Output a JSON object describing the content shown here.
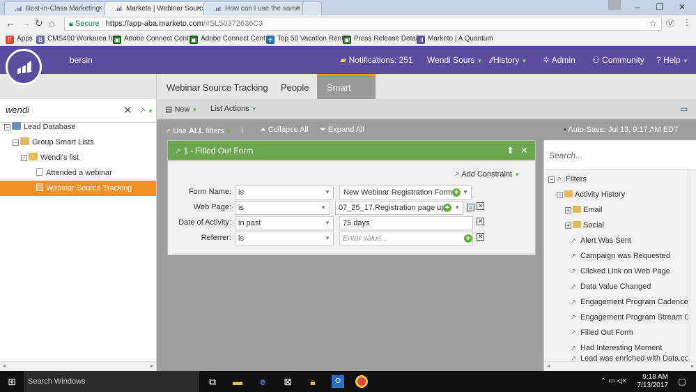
{
  "browser": {
    "tabs": [
      {
        "title": "Best-in-Class Marketing",
        "active": false
      },
      {
        "title": "Marketo | Webinar Sourc",
        "active": true
      },
      {
        "title": "How can I use the same",
        "active": false
      }
    ],
    "secure_label": "Secure",
    "url_host": "https://app-aba.marketo.com",
    "url_path": "/#SL50372636C3",
    "bookmarks": [
      {
        "label": "Apps"
      },
      {
        "label": "CMS400 Workarea fo"
      },
      {
        "label": "Adobe Connect Cent"
      },
      {
        "label": "Adobe Connect Cent"
      },
      {
        "label": "Top 50 Vacation Rent"
      },
      {
        "label": "Press Release Details"
      },
      {
        "label": "Marketo | A Quantum"
      }
    ]
  },
  "header": {
    "username": "bersin",
    "notifications": "Notifications: 251",
    "user_menu": "Wendi Sours",
    "history": "History",
    "admin": "Admin",
    "community": "Community",
    "help": "Help"
  },
  "subnav": {
    "tabs": [
      "Webinar Source Tracking",
      "People",
      "Smart List"
    ]
  },
  "left_panel": {
    "search_value": "wendi",
    "tree": [
      {
        "label": "Lead Database"
      },
      {
        "label": "Group Smart Lists"
      },
      {
        "label": "Wendi's list"
      },
      {
        "label": "Attended a webinar"
      },
      {
        "label": "Webinar Source Tracking"
      }
    ]
  },
  "toolbar": {
    "new_label": "New",
    "list_actions_label": "List Actions"
  },
  "filter_bar": {
    "use_prefix": "Use ",
    "use_all": "ALL",
    "use_suffix": " filters",
    "separator": "|",
    "collapse_all": "Collapse All",
    "expand_all": "Expand All",
    "autosave": "Auto-Save: Jul 13, 9:17 AM EDT"
  },
  "filter_card": {
    "title": "1 - Filled Out Form",
    "add_constraint": "Add Constraint",
    "rows": [
      {
        "label": "Form Name:",
        "operator": "is",
        "value": "New Webinar Registration Form"
      },
      {
        "label": "Web Page:",
        "operator": "is",
        "value": "07_25_17.Registration page upc"
      },
      {
        "label": "Date of Activity:",
        "operator": "in past",
        "value": "75 days"
      },
      {
        "label": "Referrer:",
        "operator": "is",
        "value": "",
        "placeholder": "Enter value..."
      }
    ]
  },
  "right_panel": {
    "search_placeholder": "Search...",
    "items": [
      {
        "label": "Filters"
      },
      {
        "label": "Activity History"
      },
      {
        "label": "Email"
      },
      {
        "label": "Social"
      },
      {
        "label": "Alert Was Sent"
      },
      {
        "label": "Campaign was Requested"
      },
      {
        "label": "Clicked Link on Web Page"
      },
      {
        "label": "Data Value Changed"
      },
      {
        "label": "Engagement Program Cadence C"
      },
      {
        "label": "Engagement Program Stream Ch"
      },
      {
        "label": "Filled Out Form"
      },
      {
        "label": "Had Interesting Moment"
      },
      {
        "label": "Lead was enriched with Data.co"
      }
    ]
  },
  "taskbar": {
    "search_placeholder": "Search Windows",
    "time": "9:18 AM",
    "date": "7/13/2017"
  },
  "colors": {
    "brand_purple": "#5c4c9f",
    "accent_orange": "#f29121",
    "filter_green": "#6aa84f"
  }
}
